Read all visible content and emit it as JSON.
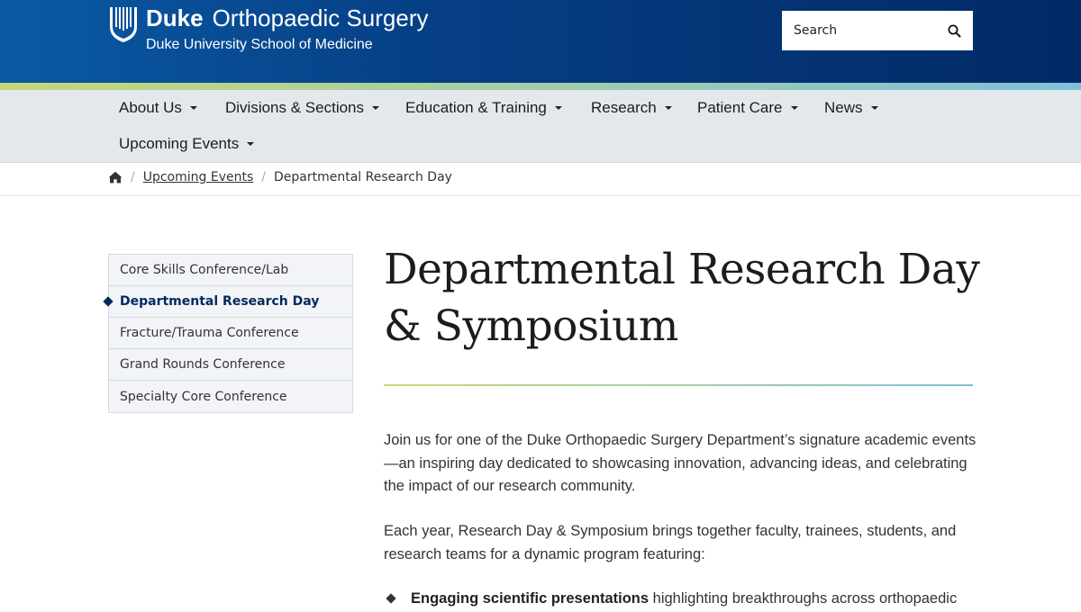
{
  "header": {
    "logo_bold": "Duke",
    "logo_name": "Orthopaedic Surgery",
    "logo_sub": "Duke University School of Medicine",
    "search_placeholder": "Search"
  },
  "nav": {
    "items": [
      {
        "label": "About Us"
      },
      {
        "label": "Divisions & Sections"
      },
      {
        "label": "Education & Training"
      },
      {
        "label": "Research"
      },
      {
        "label": "Patient Care"
      },
      {
        "label": "News"
      },
      {
        "label": "Upcoming Events"
      }
    ]
  },
  "breadcrumb": {
    "items": [
      {
        "label": "Upcoming Events"
      },
      {
        "label": "Departmental Research Day"
      }
    ]
  },
  "sidenav": {
    "items": [
      {
        "label": "Core Skills Conference/Lab",
        "active": false
      },
      {
        "label": "Departmental Research Day",
        "active": true
      },
      {
        "label": "Fracture/Trauma Conference",
        "active": false
      },
      {
        "label": "Grand Rounds Conference",
        "active": false
      },
      {
        "label": "Specialty Core Conference",
        "active": false
      }
    ]
  },
  "main": {
    "title": "Departmental Research Day & Symposium",
    "paragraphs": [
      "Join us for one of the Duke Orthopaedic Surgery Department’s signature academic events—an inspiring day dedicated to showcasing innovation, advancing ideas, and celebrating the impact of our research community.",
      "Each year, Research Day & Symposium brings together faculty, trainees, students, and research teams for a dynamic program featuring:"
    ],
    "bullets": [
      {
        "bold": "Engaging scientific presentations",
        "text": " highlighting breakthroughs across orthopaedic"
      }
    ]
  },
  "colors": {
    "header_dark": "#012a66",
    "header_light": "#0a5aa4",
    "accent_navy": "#012a5c",
    "nav_bg": "#e3e8ed"
  }
}
